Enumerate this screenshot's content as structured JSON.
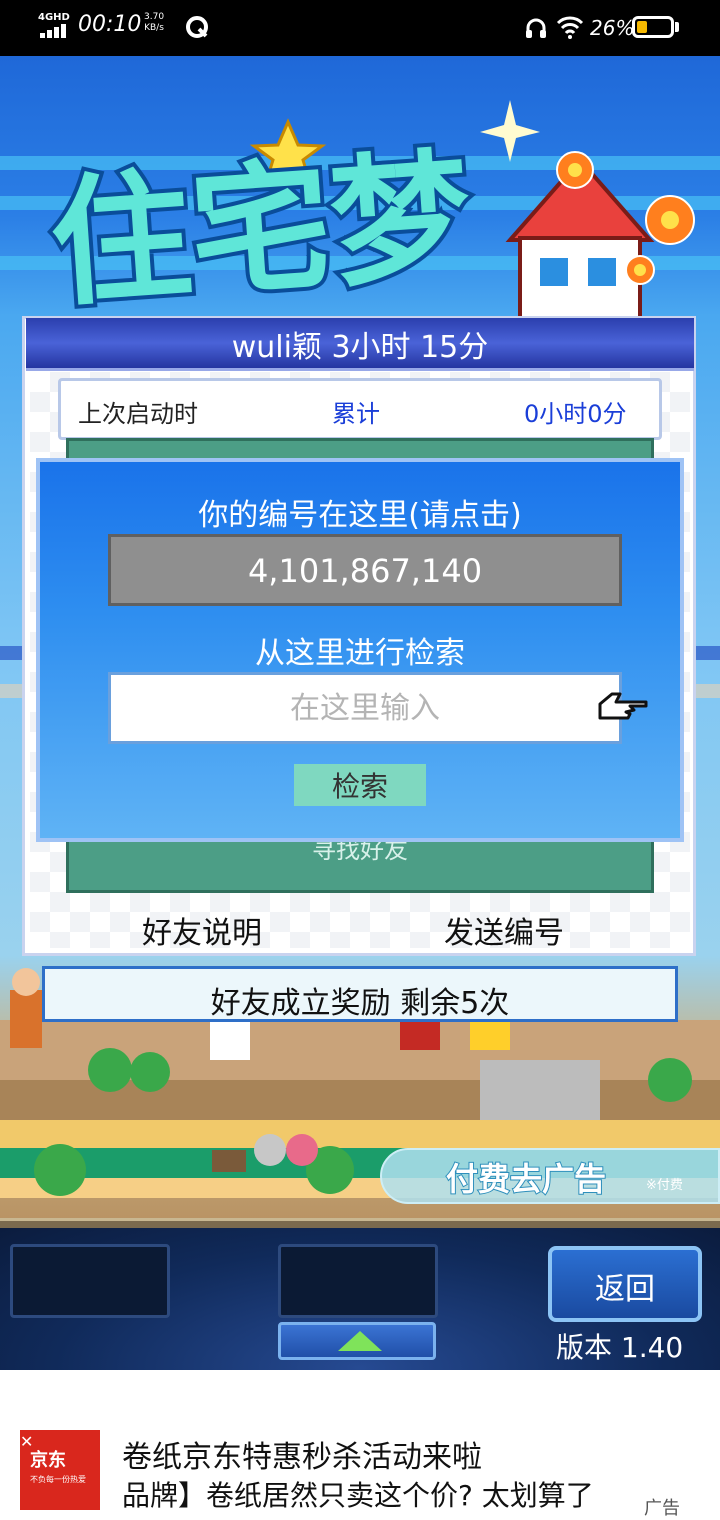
{
  "status_bar": {
    "network": "4GHD",
    "time": "00:10",
    "speed_value": "3.70",
    "speed_unit": "KB/s",
    "battery_text": "26%",
    "battery_level": 0.26,
    "icons": [
      "signal-icon",
      "q-app-icon",
      "headset-icon",
      "wifi-icon",
      "battery-icon"
    ]
  },
  "main_panel": {
    "title": "wuli颖  3小时 15分",
    "stats": {
      "last_launch_label": "上次启动时",
      "total_label": "累计",
      "total_value": "0小时0分"
    },
    "find_friends": "寻找好友",
    "friends_help_label": "好友说明",
    "send_id_label": "发送编号"
  },
  "dialog": {
    "title": "你的编号在这里(请点击)",
    "player_id": "4,101,867,140",
    "search_label": "从这里进行检索",
    "search_placeholder": "在这里输入",
    "search_button": "检索"
  },
  "reward": {
    "text": "好友成立奖励 剩余5次"
  },
  "remove_ads": {
    "label": "付费去广告",
    "paid_label": "※付费"
  },
  "controls": {
    "back_label": "返回",
    "version": "版本 1.40"
  },
  "ad_banner": {
    "brand": "京东",
    "brand_sub": "不负每一份热爱",
    "line1": "卷纸京东特惠秒杀活动来啦",
    "line2": "品牌】卷纸居然只卖这个价? 太划算了",
    "tag": "广告"
  },
  "colors": {
    "title_bar": "#2b3fae",
    "dialog": "#2e8ef0",
    "id_box": "#8f8f8f",
    "search_button": "#7fd8c0",
    "friend_list": "#4c9e86",
    "ad_brand": "#d9271d",
    "battery": "#f5b800"
  }
}
